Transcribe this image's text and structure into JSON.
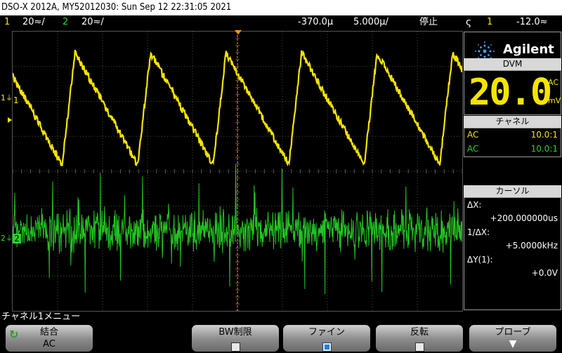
{
  "title": "DSO-X 2012A, MY52012030: Sun Sep 12 22:31:05 2021",
  "status": {
    "ch1_num": "1",
    "ch1_scale": "20≈/",
    "ch2_num": "2",
    "ch2_scale": "20≈/",
    "delay": "-370.0µ",
    "timebase": "5.000µ/",
    "run_state": "停止",
    "trig_slope_icon": "rising-edge-icon",
    "trig_source": "1",
    "trig_level": "-12.0≈"
  },
  "panel": {
    "brand": "Agilent",
    "dvm_header": "DVM",
    "dvm_value": "20.0",
    "dvm_mode": "AC",
    "dvm_unit": "mV",
    "channel_header": "チャネル",
    "channels": [
      {
        "coupling": "AC",
        "probe": "10.0:1"
      },
      {
        "coupling": "AC",
        "probe": "10.0:1"
      }
    ],
    "cursor_header": "カーソル",
    "dx_label": "ΔX:",
    "dx_value": "+200.000000us",
    "inv_dx_label": "1/ΔX:",
    "inv_dx_value": "+5.0000kHz",
    "dy_label": "ΔY(1):",
    "dy_value": "+0.0V"
  },
  "screen": {
    "ch1_marker": "1",
    "ch2_marker": "2"
  },
  "menu": {
    "title": "チャネル1メニュー",
    "softkeys": [
      {
        "label": "結合",
        "value": "AC"
      },
      {
        "label": "BW制限",
        "checked": false
      },
      {
        "label": "ファイン",
        "checked": true
      },
      {
        "label": "反転",
        "checked": false
      },
      {
        "label": "プローブ"
      }
    ]
  },
  "colors": {
    "ch1": "#f5e400",
    "ch2": "#27d827",
    "cursor": "#ff9a1a"
  }
}
